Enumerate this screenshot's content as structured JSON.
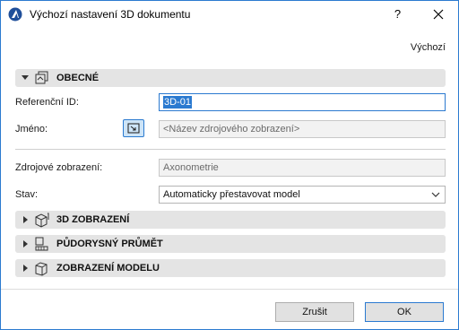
{
  "window": {
    "title": "Výchozí nastavení 3D dokumentu",
    "help_label": "?",
    "icons": {
      "app": "archicad-icon",
      "close": "close-icon"
    }
  },
  "header": {
    "defaults_label": "Výchozí"
  },
  "general": {
    "title": "OBECNÉ",
    "reference_id_label": "Referenční ID:",
    "reference_id_value": "3D-01",
    "name_label": "Jméno:",
    "name_placeholder": "<Název zdrojového zobrazení>",
    "source_view_label": "Zdrojové zobrazení:",
    "source_view_value": "Axonometrie",
    "status_label": "Stav:",
    "status_value": "Automaticky přestavovat model"
  },
  "sections": [
    {
      "title": "3D ZOBRAZENÍ",
      "icon": "3d-view-icon"
    },
    {
      "title": "PŮDORYSNÝ PRŮMĚT",
      "icon": "floor-plan-icon"
    },
    {
      "title": "ZOBRAZENÍ MODELU",
      "icon": "model-display-icon"
    }
  ],
  "footer": {
    "cancel_label": "Zrušit",
    "ok_label": "OK"
  },
  "colors": {
    "accent": "#2b7ad0",
    "section_bg": "#e4e4e4"
  }
}
